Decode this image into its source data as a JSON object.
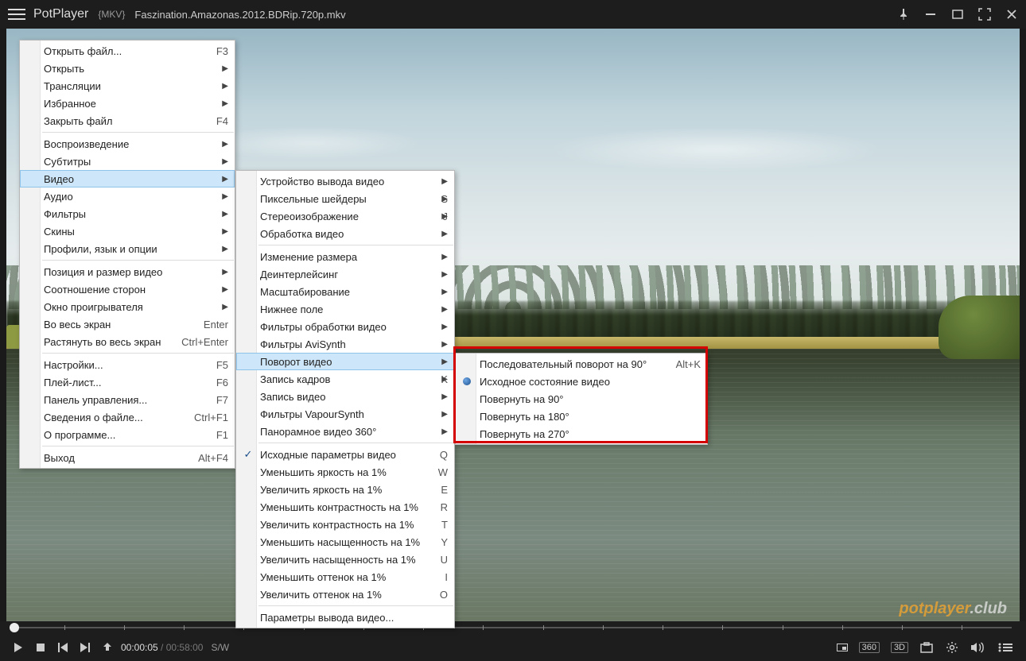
{
  "titlebar": {
    "app_name": "PotPlayer",
    "format": "{MKV}",
    "filename": "Faszination.Amazonas.2012.BDRip.720p.mkv"
  },
  "controlbar": {
    "current_time": "00:00:05",
    "total_time": "00:58:00",
    "sw": "S/W",
    "label_360": "360",
    "label_3d": "3D"
  },
  "watermark": {
    "brand": "potplayer",
    "suffix": ".club"
  },
  "menu1": {
    "items": [
      {
        "label": "Открыть файл...",
        "sc": "F3"
      },
      {
        "label": "Открыть",
        "sub": true
      },
      {
        "label": "Трансляции",
        "sub": true
      },
      {
        "label": "Избранное",
        "sub": true
      },
      {
        "label": "Закрыть файл",
        "sc": "F4"
      },
      {
        "sep": true
      },
      {
        "label": "Воспроизведение",
        "sub": true
      },
      {
        "label": "Субтитры",
        "sub": true
      },
      {
        "label": "Видео",
        "sub": true,
        "hover": true
      },
      {
        "label": "Аудио",
        "sub": true
      },
      {
        "label": "Фильтры",
        "sub": true
      },
      {
        "label": "Скины",
        "sub": true
      },
      {
        "label": "Профили, язык и опции",
        "sub": true
      },
      {
        "sep": true
      },
      {
        "label": "Позиция и размер видео",
        "sub": true
      },
      {
        "label": "Соотношение сторон",
        "sub": true
      },
      {
        "label": "Окно проигрывателя",
        "sub": true
      },
      {
        "label": "Во весь экран",
        "sc": "Enter"
      },
      {
        "label": "Растянуть во весь экран",
        "sc": "Ctrl+Enter"
      },
      {
        "sep": true
      },
      {
        "label": "Настройки...",
        "sc": "F5"
      },
      {
        "label": "Плей-лист...",
        "sc": "F6"
      },
      {
        "label": "Панель управления...",
        "sc": "F7"
      },
      {
        "label": "Сведения о файле...",
        "sc": "Ctrl+F1"
      },
      {
        "label": "О программе...",
        "sc": "F1"
      },
      {
        "sep": true
      },
      {
        "label": "Выход",
        "sc": "Alt+F4"
      }
    ]
  },
  "menu2": {
    "items": [
      {
        "label": "Устройство вывода видео",
        "sub": true
      },
      {
        "label": "Пиксельные шейдеры",
        "sc": "S",
        "sub": true
      },
      {
        "label": "Стереоизображение",
        "sc": "J",
        "sub": true
      },
      {
        "label": "Обработка видео",
        "sub": true
      },
      {
        "sep": true
      },
      {
        "label": "Изменение размера",
        "sub": true
      },
      {
        "label": "Деинтерлейсинг",
        "sub": true
      },
      {
        "label": "Масштабирование",
        "sub": true
      },
      {
        "label": "Нижнее поле",
        "sub": true
      },
      {
        "label": "Фильтры обработки видео",
        "sub": true
      },
      {
        "label": "Фильтры AviSynth",
        "sub": true
      },
      {
        "label": "Поворот видео",
        "sub": true,
        "hover": true
      },
      {
        "label": "Запись кадров",
        "sc": "K",
        "sub": true
      },
      {
        "label": "Запись видео",
        "sub": true
      },
      {
        "label": "Фильтры VapourSynth",
        "sub": true
      },
      {
        "label": "Панорамное видео 360°",
        "sub": true
      },
      {
        "sep": true
      },
      {
        "label": "Исходные параметры видео",
        "sc": "Q",
        "check": true
      },
      {
        "label": "Уменьшить яркость на 1%",
        "sc": "W"
      },
      {
        "label": "Увеличить яркость на 1%",
        "sc": "E"
      },
      {
        "label": "Уменьшить контрастность на 1%",
        "sc": "R"
      },
      {
        "label": "Увеличить контрастность на 1%",
        "sc": "T"
      },
      {
        "label": "Уменьшить насыщенность на 1%",
        "sc": "Y"
      },
      {
        "label": "Увеличить насыщенность на 1%",
        "sc": "U"
      },
      {
        "label": "Уменьшить оттенок на 1%",
        "sc": "I"
      },
      {
        "label": "Увеличить оттенок на 1%",
        "sc": "O"
      },
      {
        "sep": true
      },
      {
        "label": "Параметры вывода видео..."
      }
    ]
  },
  "menu3": {
    "items": [
      {
        "label": "Последовательный поворот на 90°",
        "sc": "Alt+K"
      },
      {
        "label": "Исходное состояние видео",
        "radio": true
      },
      {
        "label": "Повернуть на 90°"
      },
      {
        "label": "Повернуть на 180°"
      },
      {
        "label": "Повернуть на 270°"
      }
    ]
  }
}
